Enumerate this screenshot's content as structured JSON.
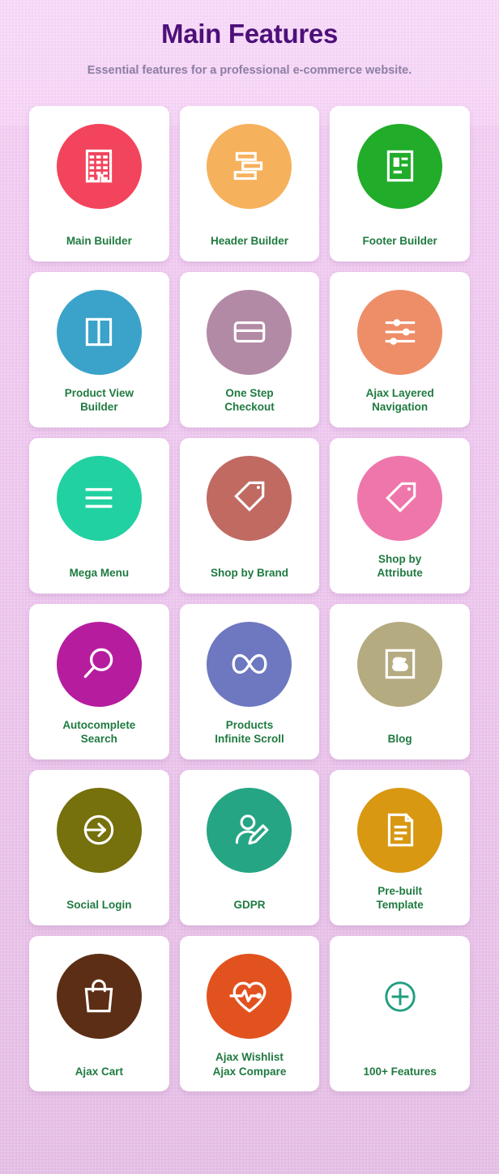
{
  "header": {
    "title": "Main Features",
    "subtitle": "Essential features for a professional\ne-commerce website.",
    "title_color": "#4d1079",
    "subtitle_color": "#8c7fa3"
  },
  "theme": {
    "background_top": "#f6d7f7",
    "background_bottom": "#e5bfe5",
    "card_background": "#ffffff",
    "label_color": "#1f7a40"
  },
  "features": [
    {
      "label": "Main Builder",
      "icon": "building-icon",
      "color": "#f2445c"
    },
    {
      "label": "Header Builder",
      "icon": "stacked-bars-icon",
      "color": "#f6b15c"
    },
    {
      "label": "Footer Builder",
      "icon": "document-lines-icon",
      "color": "#21ac2a"
    },
    {
      "label": "Product View\nBuilder",
      "icon": "columns-icon",
      "color": "#3ba3c9"
    },
    {
      "label": "One Step\nCheckout",
      "icon": "credit-card-icon",
      "color": "#b38aa6"
    },
    {
      "label": "Ajax Layered\nNavigation",
      "icon": "sliders-icon",
      "color": "#ee8e68"
    },
    {
      "label": "Mega Menu",
      "icon": "hamburger-menu-icon",
      "color": "#21d1a1"
    },
    {
      "label": "Shop by Brand",
      "icon": "double-tag-icon",
      "color": "#c06a62"
    },
    {
      "label": "Shop by\nAttribute",
      "icon": "tag-icon",
      "color": "#ef76ab"
    },
    {
      "label": "Autocomplete\nSearch",
      "icon": "magnifier-icon",
      "color": "#b51d9e"
    },
    {
      "label": "Products\nInfinite Scroll",
      "icon": "infinity-icon",
      "color": "#6d78c0"
    },
    {
      "label": "Blog",
      "icon": "blogger-b-icon",
      "color": "#b5ab81"
    },
    {
      "label": "Social Login",
      "icon": "login-arrow-icon",
      "color": "#76700d"
    },
    {
      "label": "GDPR",
      "icon": "user-edit-icon",
      "color": "#25a584"
    },
    {
      "label": "Pre-built\nTemplate",
      "icon": "file-document-icon",
      "color": "#d99812"
    },
    {
      "label": "Ajax Cart",
      "icon": "shopping-bag-icon",
      "color": "#5c2e15"
    },
    {
      "label": "Ajax Wishlist\nAjax Compare",
      "icon": "heart-pulse-icon",
      "color": "#e2521f"
    },
    {
      "label": "100+ Features",
      "icon": "plus-circle-icon",
      "color": "#ffffff",
      "icon_stroke": "#1f9e7e",
      "plain": true
    }
  ]
}
